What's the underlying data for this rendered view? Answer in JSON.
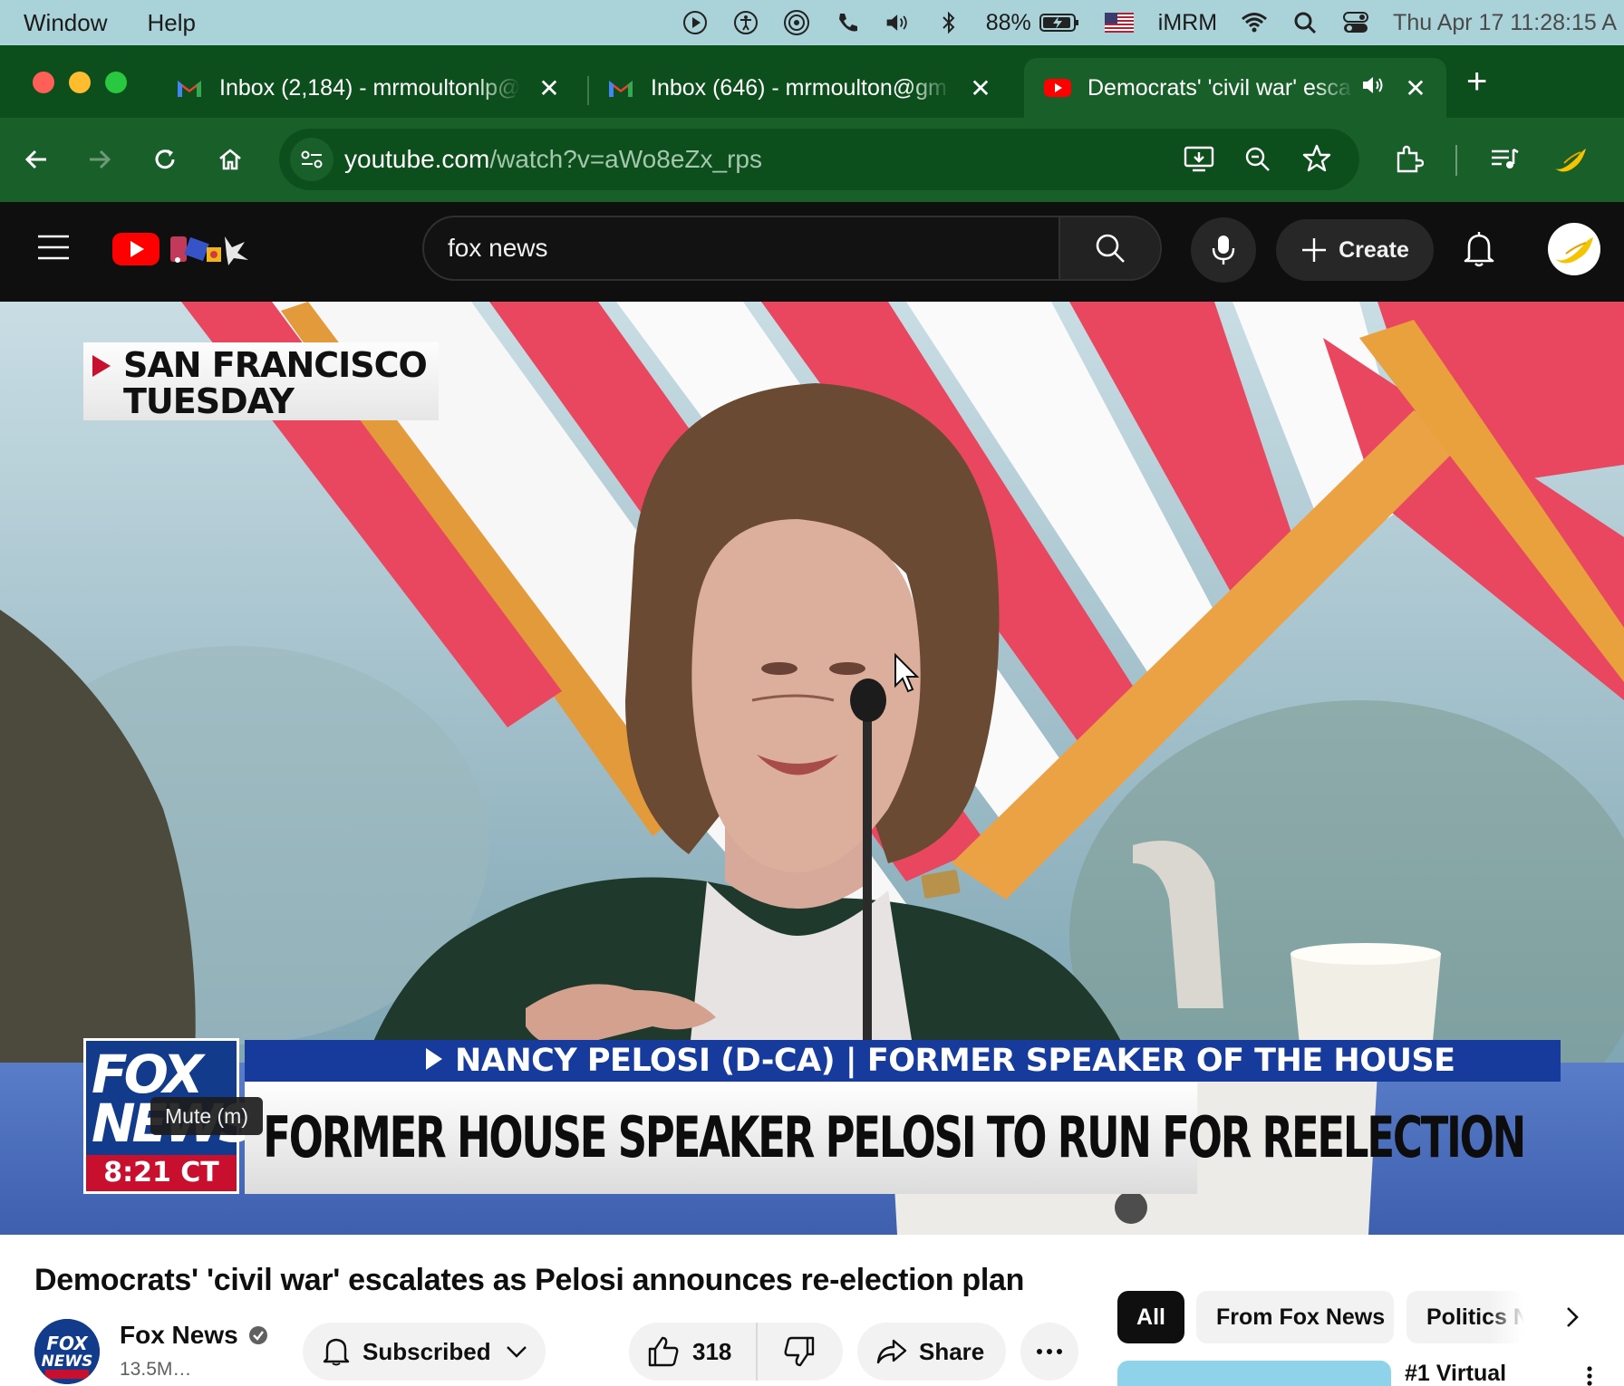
{
  "menubar": {
    "items": [
      "Window",
      "Help"
    ],
    "battery": "88%",
    "user": "iMRM",
    "clock": "Thu Apr 17  11:28:15 A"
  },
  "tabs": [
    {
      "title": "Inbox (2,184) - mrmoultonlp@",
      "icon": "gmail-icon",
      "active": false
    },
    {
      "title": "Inbox (646) - mrmoulton@gm",
      "icon": "gmail-icon",
      "active": false
    },
    {
      "title": "Democrats' 'civil war' esca",
      "icon": "youtube-icon",
      "active": true
    }
  ],
  "address": {
    "host": "youtube.com",
    "path": "/watch?v=aWo8eZx_rps"
  },
  "youtube": {
    "search_value": "fox news",
    "create_label": "Create"
  },
  "video": {
    "location_line1": "SAN FRANCISCO",
    "location_line2": "TUESDAY",
    "logo_text_line1": "FOX",
    "logo_text_line2": "NEWS",
    "logo_time": "8:21 CT",
    "chyron_top": "NANCY PELOSI (D-CA) | FORMER SPEAKER OF THE HOUSE",
    "chyron_main": "FORMER HOUSE SPEAKER PELOSI TO RUN FOR REELECTION",
    "tooltip": "Mute (m)"
  },
  "watch": {
    "title": "Democrats' 'civil war' escalates as Pelosi announces re-election plan",
    "channel_name": "Fox News",
    "channel_subs": "13.5M…",
    "subscribe_label": "Subscribed",
    "like_count": "318",
    "share_label": "Share"
  },
  "chips": [
    "All",
    "From Fox News",
    "Politics N"
  ],
  "recommendation": {
    "title": "#1 Virtual"
  },
  "colors": {
    "menubar": "#a9d3d8",
    "browser_frame": "#0c4f1c",
    "browser_toolbar": "#185f2a",
    "youtube_dark": "#0f0f0f",
    "youtube_red": "#ff0000",
    "fox_blue": "#173a9d",
    "fox_red": "#c8102e"
  }
}
